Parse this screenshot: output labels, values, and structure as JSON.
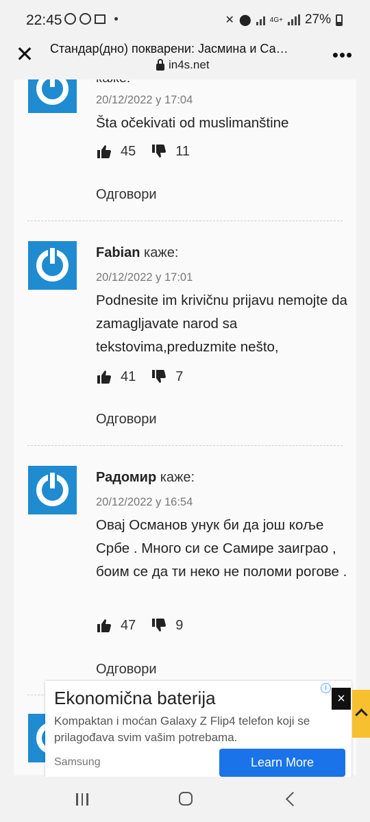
{
  "status_bar": {
    "time": "22:45",
    "battery": "27%",
    "network_label": "4G+"
  },
  "browser": {
    "page_title": "Стандар(дно) покварени: Јасмина и Са…",
    "url": "in4s.net"
  },
  "comments": [
    {
      "author": "",
      "says": "каже:",
      "date": "20/12/2022 у 17:04",
      "text": "Šta očekivati od muslimanštine",
      "likes": "45",
      "dislikes": "11",
      "reply": "Одговори"
    },
    {
      "author": "Fabian",
      "says": "каже:",
      "date": "20/12/2022 у 17:01",
      "text": "Podnesite im krivičnu prijavu nemojte da zamagljavate narod sa tekstovima,preduzmite nešto,",
      "likes": "41",
      "dislikes": "7",
      "reply": "Одговори"
    },
    {
      "author": "Радомир",
      "says": "каже:",
      "date": "20/12/2022 у 16:54",
      "text": "Овај Османов унук би да још коље Србе . Много си се Самире заиграо , боим се да ти неко не поломи рогове .",
      "likes": "47",
      "dislikes": "9",
      "reply": "Одговори"
    }
  ],
  "ad": {
    "title": "Ekonomična baterija",
    "description": "Kompaktan i moćan Galaxy Z Flip4 telefon koji se prilagođava svim vašim potrebama.",
    "brand": "Samsung",
    "cta": "Learn More",
    "close": "×"
  },
  "colors": {
    "avatar_blue": "#1f8bd1",
    "cta_blue": "#1a73e8",
    "side_tab_yellow": "#f7c02f"
  }
}
